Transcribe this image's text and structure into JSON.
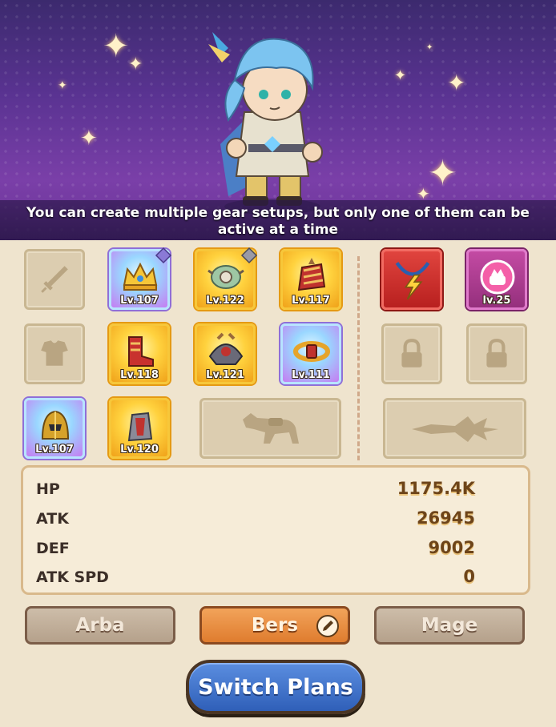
{
  "banner": {
    "hint": "You can create multiple gear setups, but only one of them can be active at a time"
  },
  "gear": {
    "row1": [
      {
        "slot": "weapon",
        "state": "empty",
        "icon": "sword-icon"
      },
      {
        "slot": "helm",
        "state": "equipped",
        "rarity": "blue",
        "level": "Lv.107",
        "icon": "crown-icon",
        "badge": "upgrade-icon"
      },
      {
        "slot": "amulet",
        "state": "equipped",
        "rarity": "gold",
        "level": "Lv.122",
        "icon": "amulet-icon",
        "badge": "upgrade-icon"
      },
      {
        "slot": "gloves",
        "state": "equipped",
        "rarity": "gold",
        "level": "Lv.117",
        "icon": "gauntlet-icon"
      }
    ],
    "row2": [
      {
        "slot": "armor",
        "state": "empty",
        "icon": "armor-icon"
      },
      {
        "slot": "boots",
        "state": "equipped",
        "rarity": "gold",
        "level": "Lv.118",
        "icon": "boots-icon"
      },
      {
        "slot": "shoulder",
        "state": "equipped",
        "rarity": "gold",
        "level": "Lv.121",
        "icon": "shoulder-icon"
      },
      {
        "slot": "belt",
        "state": "equipped",
        "rarity": "blue",
        "level": "Lv.111",
        "icon": "belt-icon"
      }
    ],
    "row3": [
      {
        "slot": "ring",
        "state": "equipped",
        "rarity": "blue",
        "level": "Lv.107",
        "icon": "helmet-icon"
      },
      {
        "slot": "bracer",
        "state": "equipped",
        "rarity": "gold",
        "level": "Lv.120",
        "icon": "bracer-icon"
      }
    ],
    "special": [
      {
        "slot": "necklace",
        "icon": "lightning-necklace-icon"
      },
      {
        "slot": "pet",
        "level": "lv.25",
        "icon": "pet-icon"
      }
    ],
    "locked": [
      "lock-icon",
      "lock-icon"
    ],
    "mount_icon": "horse-icon",
    "wing_icon": "wing-icon"
  },
  "stats": [
    {
      "name": "HP",
      "value": "1175.4K"
    },
    {
      "name": "ATK",
      "value": "26945"
    },
    {
      "name": "DEF",
      "value": "9002"
    },
    {
      "name": "ATK SPD",
      "value": "0"
    }
  ],
  "plans": {
    "left": "Arba",
    "center": "Bers",
    "right": "Mage",
    "active": "center",
    "edit_icon": "pencil-icon"
  },
  "switch_button": "Switch Plans",
  "colors": {
    "banner": "#5a3392",
    "panel": "#efe4ce",
    "active_plan": "#e88c3e",
    "switch_button": "#3f72cc"
  }
}
